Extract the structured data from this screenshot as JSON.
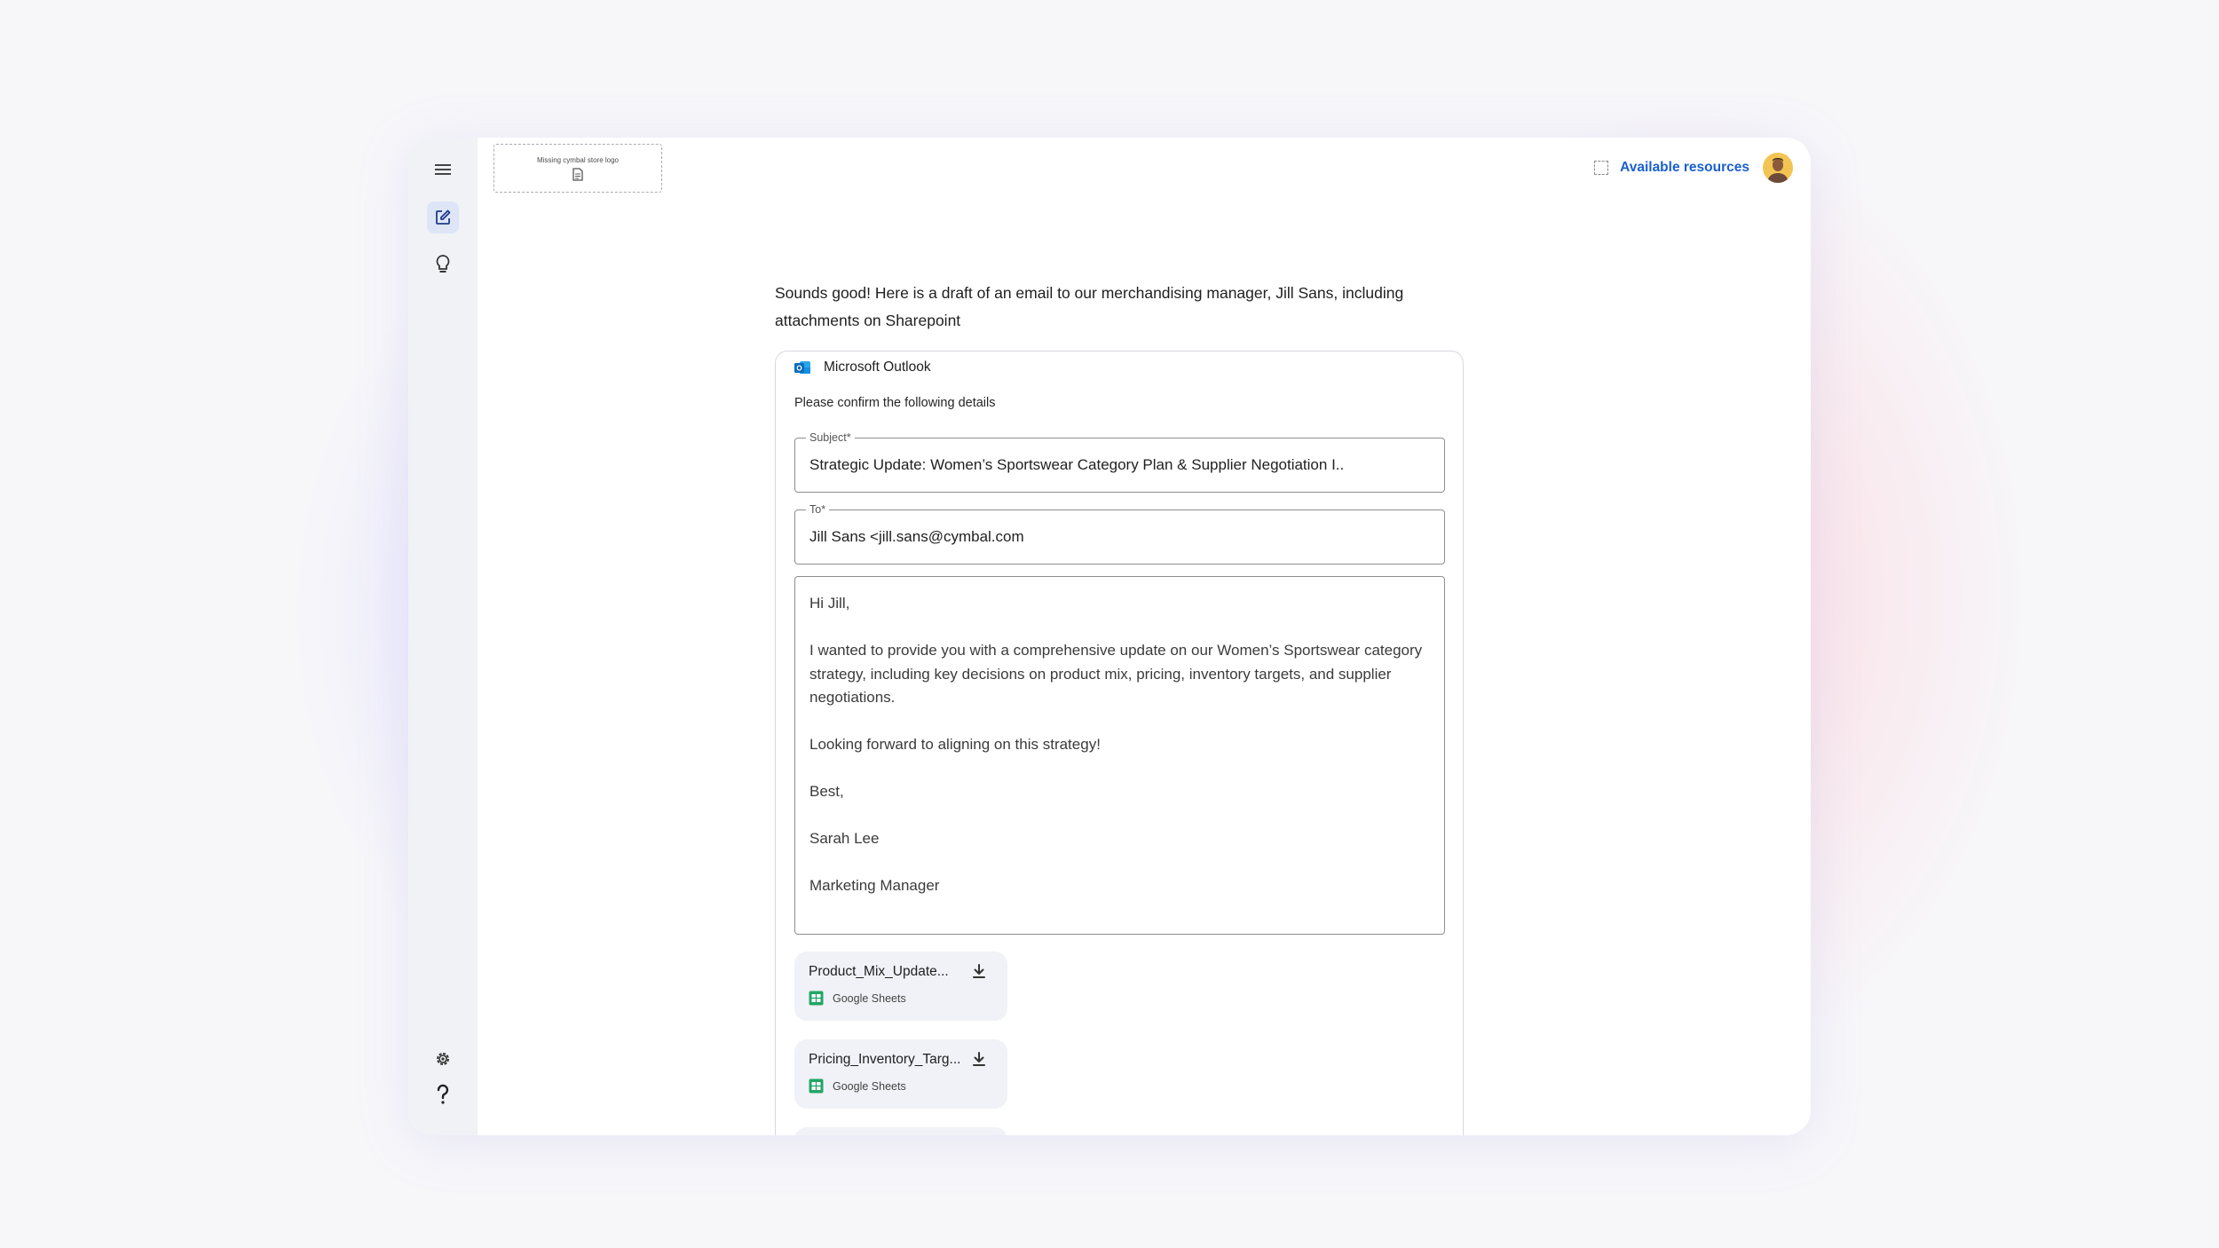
{
  "header": {
    "logo_placeholder": "Missing cymbal store logo",
    "resources_link": "Available resources"
  },
  "sidebar": {
    "items": [
      "menu",
      "compose",
      "ideas",
      "settings",
      "help"
    ]
  },
  "chat": {
    "intro": "Sounds good! Here is a draft of an email to our merchandising manager, Jill Sans, including attachments on Sharepoint"
  },
  "email_card": {
    "app_name": "Microsoft Outlook",
    "instruction": "Please confirm the following details",
    "subject_label": "Subject*",
    "subject_value": "Strategic Update: Women’s Sportswear Category Plan & Supplier Negotiation I..",
    "to_label": "To*",
    "to_value": "Jill Sans <jill.sans@cymbal.com",
    "body": {
      "greeting": "Hi Jill,",
      "paragraph": "I wanted to provide you with a comprehensive update on our Women’s Sportswear category strategy, including key decisions on product mix, pricing, inventory targets, and supplier negotiations.",
      "closing_line": "Looking forward to aligning on this strategy!",
      "sign_off": "Best,",
      "sender_name": "Sarah Lee",
      "sender_title": "Marketing Manager"
    },
    "attachments": [
      {
        "name": "Product_Mix_Update...",
        "type": "Google Sheets"
      },
      {
        "name": "Pricing_Inventory_Targ...",
        "type": "Google Sheets"
      }
    ]
  },
  "colors": {
    "accent": "#1a5fd0",
    "sheets_green": "#23a566",
    "outlook_blue": "#0f6cbd"
  }
}
